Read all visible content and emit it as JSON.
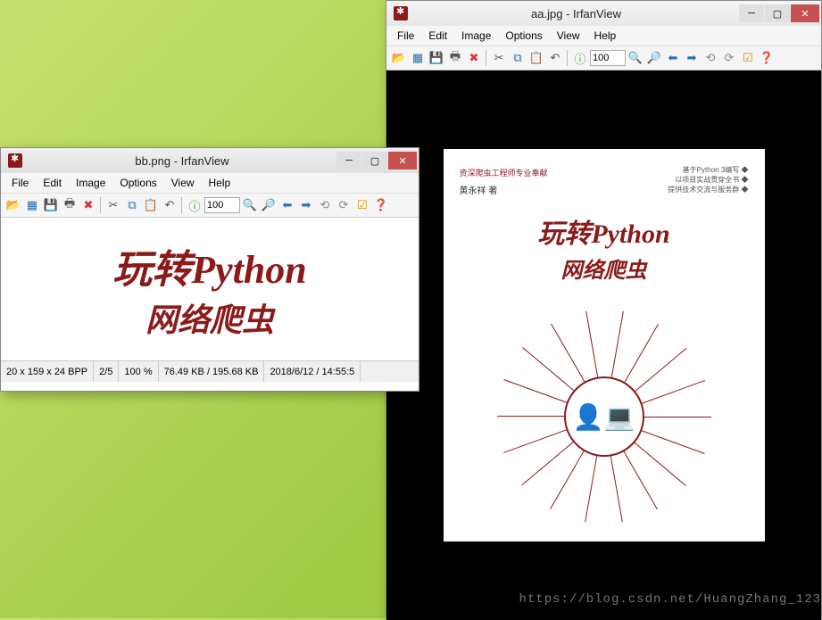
{
  "windows": {
    "aa": {
      "title": "aa.jpg - IrfanView",
      "menus": [
        "File",
        "Edit",
        "Image",
        "Options",
        "View",
        "Help"
      ],
      "zoom": "100"
    },
    "bb": {
      "title": "bb.png - IrfanView",
      "menus": [
        "File",
        "Edit",
        "Image",
        "Options",
        "View",
        "Help"
      ],
      "zoom": "100",
      "status": {
        "dims": "20 x 159 x 24 BPP",
        "page": "2/5",
        "zoom": "100 %",
        "size": "76.49 KB / 195.68 KB",
        "date": "2018/6/12 / 14:55:5"
      }
    }
  },
  "book": {
    "topLeft": "资深爬虫工程师专业奉献",
    "author": "黄永祥 著",
    "topRight1": "基于Python 3编写 ◆",
    "topRight2": "以项目实战贯穿全书 ◆",
    "topRight3": "提供技术交流与服务群 ◆",
    "title1_a": "玩转",
    "title1_b": "Python",
    "title2": "网络爬虫"
  },
  "watermark": "https://blog.csdn.net/HuangZhang_123"
}
